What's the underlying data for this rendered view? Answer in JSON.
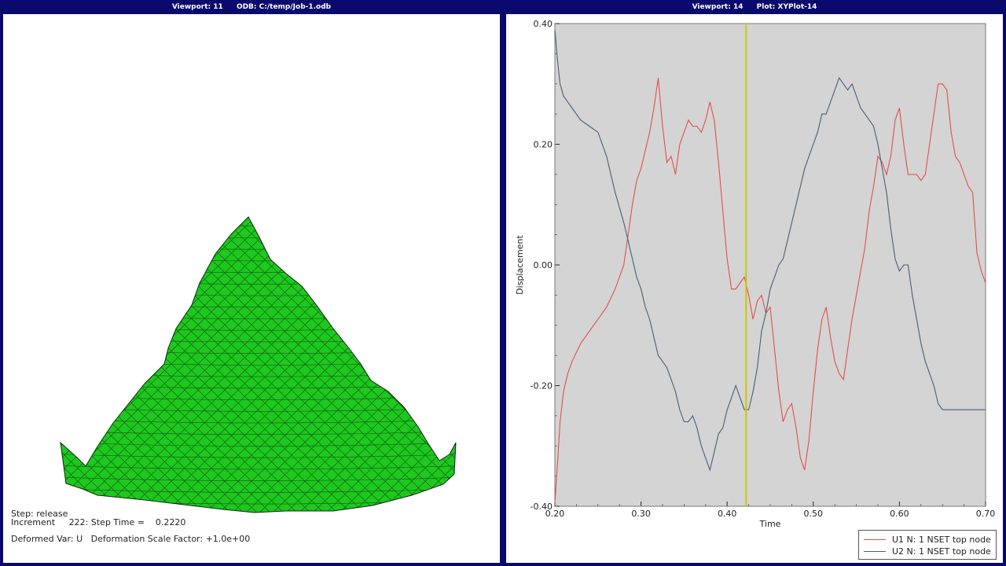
{
  "left_viewport": {
    "viewport_label": "Viewport: 11",
    "odb_label": "ODB: C:/temp/Job-1.odb",
    "step_line": "Step: release",
    "increment_line": "Increment     222: Step Time =    0.2220",
    "deformed_line": "Deformed Var: U   Deformation Scale Factor: +1.0e+00",
    "mesh_color": "#1ec81e",
    "mesh_line_color": "#0b3a0b"
  },
  "right_viewport": {
    "viewport_label": "Viewport: 14",
    "plot_label": "Plot: XYPlot-14"
  },
  "chart_data": {
    "type": "line",
    "xlabel": "Time",
    "ylabel": "Displacement",
    "xlim": [
      0.2,
      0.7
    ],
    "ylim": [
      -0.4,
      0.4
    ],
    "x_ticks": [
      "0.20",
      "0.30",
      "0.40",
      "0.50",
      "0.60",
      "0.70"
    ],
    "y_ticks": [
      "-0.40",
      "-0.20",
      "0.00",
      "0.20",
      "0.40"
    ],
    "grid": false,
    "background": "#d4d4d4",
    "cursor_x": 0.422,
    "cursor_color": "#c8c800",
    "legend_position": "bottom-right",
    "series": [
      {
        "name": "U1 N: 1 NSET top node",
        "color": "#e0504a",
        "x": [
          0.2,
          0.203,
          0.206,
          0.21,
          0.215,
          0.22,
          0.23,
          0.24,
          0.25,
          0.26,
          0.27,
          0.28,
          0.285,
          0.29,
          0.295,
          0.3,
          0.305,
          0.31,
          0.315,
          0.32,
          0.325,
          0.33,
          0.335,
          0.34,
          0.345,
          0.35,
          0.355,
          0.36,
          0.365,
          0.37,
          0.375,
          0.38,
          0.385,
          0.39,
          0.395,
          0.4,
          0.405,
          0.41,
          0.415,
          0.42,
          0.425,
          0.43,
          0.435,
          0.44,
          0.445,
          0.45,
          0.455,
          0.46,
          0.465,
          0.47,
          0.475,
          0.48,
          0.485,
          0.49,
          0.495,
          0.5,
          0.505,
          0.51,
          0.515,
          0.52,
          0.525,
          0.53,
          0.535,
          0.54,
          0.545,
          0.55,
          0.555,
          0.56,
          0.565,
          0.57,
          0.575,
          0.58,
          0.585,
          0.59,
          0.595,
          0.6,
          0.605,
          0.61,
          0.615,
          0.62,
          0.625,
          0.63,
          0.635,
          0.64,
          0.645,
          0.65,
          0.655,
          0.66,
          0.665,
          0.67,
          0.675,
          0.68,
          0.685,
          0.69,
          0.695,
          0.7
        ],
        "y": [
          -0.395,
          -0.33,
          -0.26,
          -0.21,
          -0.18,
          -0.16,
          -0.13,
          -0.11,
          -0.09,
          -0.07,
          -0.04,
          0.0,
          0.05,
          0.1,
          0.14,
          0.16,
          0.19,
          0.22,
          0.26,
          0.31,
          0.23,
          0.17,
          0.18,
          0.15,
          0.2,
          0.22,
          0.24,
          0.23,
          0.23,
          0.22,
          0.24,
          0.27,
          0.24,
          0.17,
          0.09,
          0.01,
          -0.04,
          -0.04,
          -0.03,
          -0.02,
          -0.05,
          -0.09,
          -0.06,
          -0.05,
          -0.08,
          -0.07,
          -0.14,
          -0.21,
          -0.26,
          -0.24,
          -0.23,
          -0.27,
          -0.32,
          -0.34,
          -0.29,
          -0.21,
          -0.14,
          -0.09,
          -0.07,
          -0.12,
          -0.16,
          -0.18,
          -0.19,
          -0.14,
          -0.09,
          -0.05,
          -0.01,
          0.03,
          0.09,
          0.13,
          0.18,
          0.17,
          0.15,
          0.18,
          0.24,
          0.26,
          0.2,
          0.15,
          0.15,
          0.15,
          0.14,
          0.15,
          0.2,
          0.25,
          0.3,
          0.3,
          0.29,
          0.22,
          0.18,
          0.17,
          0.15,
          0.13,
          0.12,
          0.02,
          -0.01,
          -0.03
        ]
      },
      {
        "name": "U2 N: 1 NSET top node",
        "color": "#4a5e78",
        "x": [
          0.2,
          0.203,
          0.206,
          0.21,
          0.215,
          0.22,
          0.23,
          0.24,
          0.25,
          0.26,
          0.27,
          0.28,
          0.285,
          0.29,
          0.295,
          0.3,
          0.305,
          0.31,
          0.315,
          0.32,
          0.325,
          0.33,
          0.335,
          0.34,
          0.345,
          0.35,
          0.355,
          0.36,
          0.365,
          0.37,
          0.375,
          0.38,
          0.385,
          0.39,
          0.395,
          0.4,
          0.405,
          0.41,
          0.415,
          0.42,
          0.425,
          0.43,
          0.435,
          0.44,
          0.445,
          0.45,
          0.455,
          0.46,
          0.465,
          0.47,
          0.475,
          0.48,
          0.485,
          0.49,
          0.495,
          0.5,
          0.505,
          0.51,
          0.515,
          0.52,
          0.525,
          0.53,
          0.535,
          0.54,
          0.545,
          0.55,
          0.555,
          0.56,
          0.565,
          0.57,
          0.575,
          0.58,
          0.585,
          0.59,
          0.595,
          0.6,
          0.605,
          0.61,
          0.615,
          0.62,
          0.625,
          0.63,
          0.635,
          0.64,
          0.645,
          0.65,
          0.655,
          0.66,
          0.665,
          0.67,
          0.675,
          0.68,
          0.685,
          0.69,
          0.695,
          0.7
        ],
        "y": [
          0.39,
          0.34,
          0.3,
          0.28,
          0.27,
          0.26,
          0.24,
          0.23,
          0.22,
          0.18,
          0.12,
          0.07,
          0.04,
          0.01,
          -0.02,
          -0.04,
          -0.07,
          -0.09,
          -0.12,
          -0.15,
          -0.16,
          -0.17,
          -0.19,
          -0.21,
          -0.24,
          -0.26,
          -0.26,
          -0.25,
          -0.27,
          -0.3,
          -0.32,
          -0.34,
          -0.31,
          -0.28,
          -0.27,
          -0.24,
          -0.22,
          -0.2,
          -0.22,
          -0.24,
          -0.24,
          -0.21,
          -0.17,
          -0.11,
          -0.08,
          -0.04,
          -0.02,
          0.0,
          0.01,
          0.04,
          0.07,
          0.1,
          0.13,
          0.16,
          0.18,
          0.2,
          0.22,
          0.25,
          0.25,
          0.27,
          0.29,
          0.31,
          0.3,
          0.29,
          0.3,
          0.28,
          0.26,
          0.25,
          0.24,
          0.23,
          0.2,
          0.16,
          0.12,
          0.06,
          0.01,
          -0.01,
          0.0,
          0.0,
          -0.05,
          -0.09,
          -0.13,
          -0.16,
          -0.18,
          -0.2,
          -0.23,
          -0.24,
          -0.24,
          -0.24,
          -0.24,
          -0.24,
          -0.24,
          -0.24,
          -0.24,
          -0.24,
          -0.24,
          -0.24
        ]
      }
    ]
  }
}
